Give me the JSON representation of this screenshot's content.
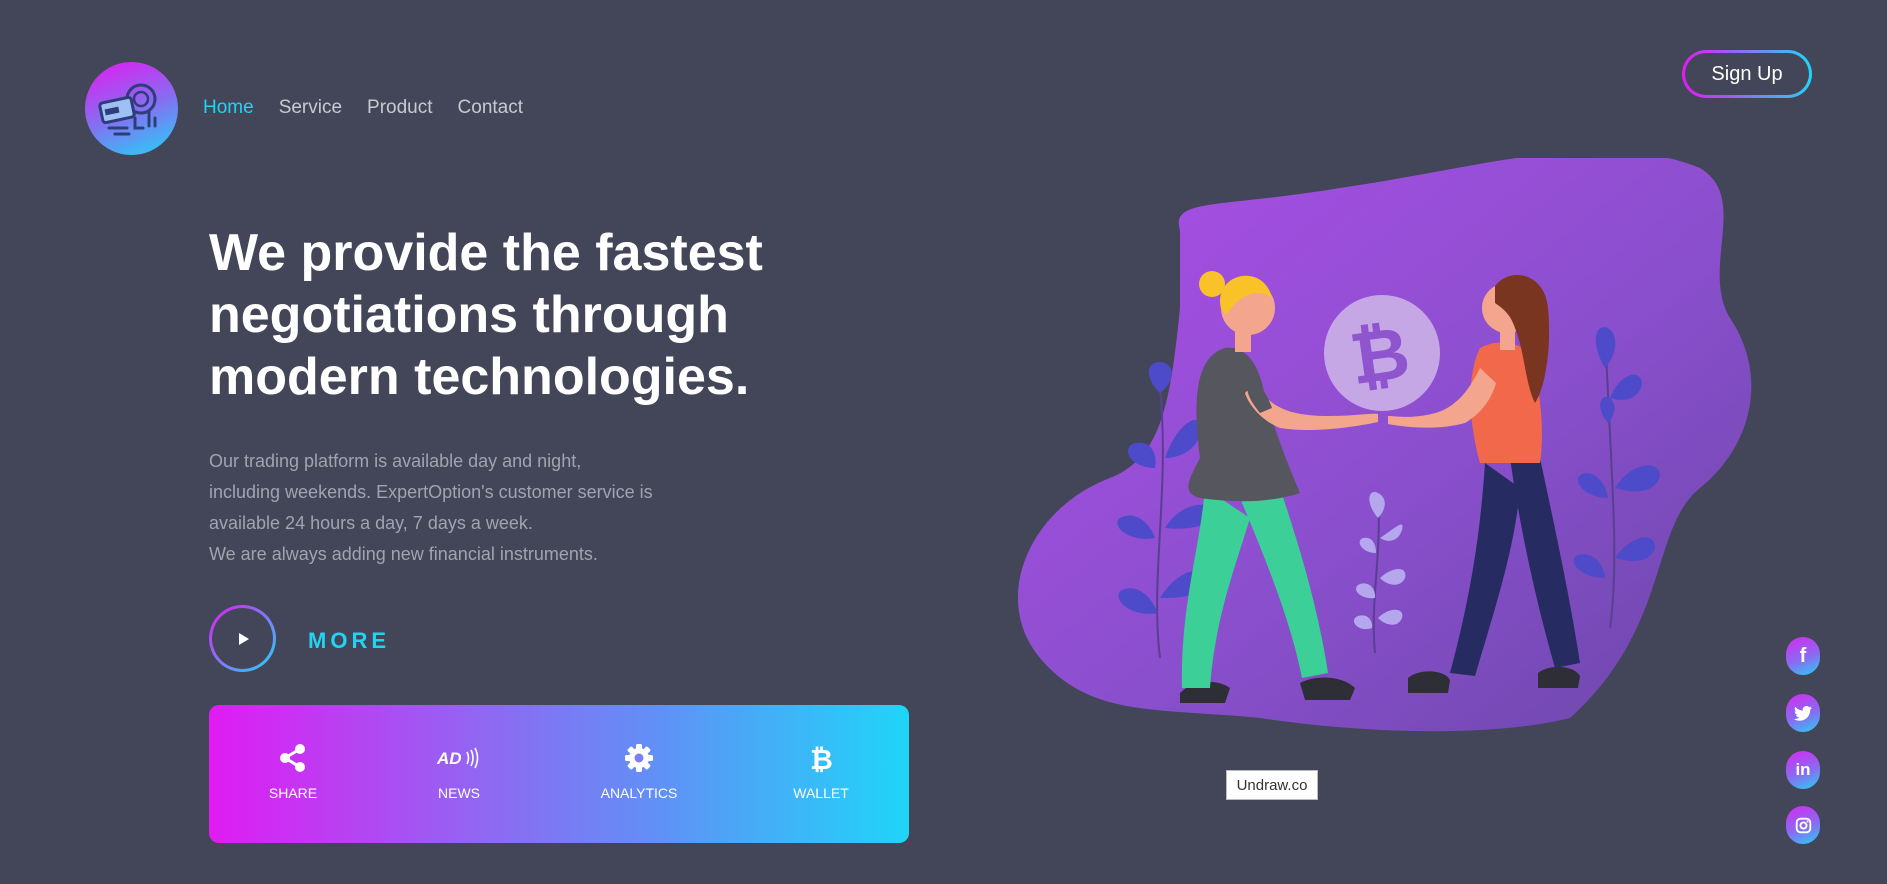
{
  "nav": {
    "items": [
      {
        "label": "Home"
      },
      {
        "label": "Service"
      },
      {
        "label": "Product"
      },
      {
        "label": "Contact"
      }
    ],
    "signup_label": "Sign Up"
  },
  "hero": {
    "title_lines": [
      "We provide the fastest",
      "negotiations through",
      "modern technologies."
    ],
    "description_lines": [
      "Our trading platform is available day and night,",
      "including weekends. ExpertOption's customer service is",
      "available 24 hours a day, 7 days a week.",
      "We are always adding new financial instruments."
    ],
    "more_label": "MORE"
  },
  "features": [
    {
      "label": "SHARE",
      "icon": "share-icon"
    },
    {
      "label": "NEWS",
      "icon": "ad-icon"
    },
    {
      "label": "ANALYTICS",
      "icon": "gear-icon"
    },
    {
      "label": "WALLET",
      "icon": "bitcoin-icon"
    }
  ],
  "illustration": {
    "coin_symbol": "₿",
    "credit": "Undraw.co"
  },
  "social": [
    {
      "icon": "facebook-icon",
      "glyph": "f"
    },
    {
      "icon": "twitter-icon",
      "glyph": ""
    },
    {
      "icon": "linkedin-icon",
      "glyph": "in"
    },
    {
      "icon": "instagram-icon",
      "glyph": ""
    }
  ],
  "colors": {
    "background": "#434659",
    "accent_cyan": "#22d3f4",
    "accent_magenta": "#e21bf2",
    "blob_purple": "#8e55cf"
  }
}
